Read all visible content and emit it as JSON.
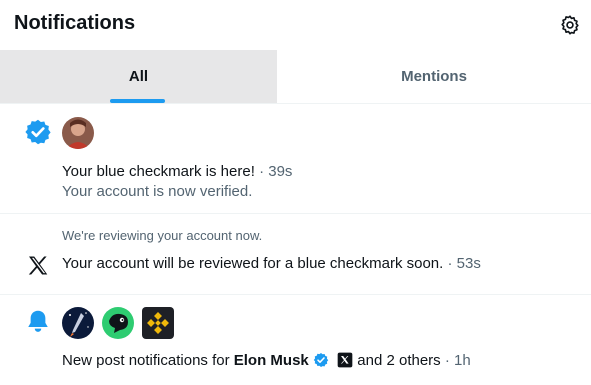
{
  "header": {
    "title": "Notifications",
    "settings_icon": "gear-icon"
  },
  "tabs": [
    {
      "label": "All",
      "active": true
    },
    {
      "label": "Mentions",
      "active": false
    }
  ],
  "notifications": [
    {
      "icon": "verified-badge-icon",
      "title": "Your blue checkmark is here!",
      "time": "· 39s",
      "subtitle": "Your account is now verified."
    },
    {
      "icon": "x-logo-icon",
      "context": "We're reviewing your account now.",
      "title": "Your account will be reviewed for a blue checkmark soon.",
      "time": "· 53s"
    },
    {
      "icon": "bell-icon",
      "prefix": "New post notifications for",
      "name": "Elon Musk",
      "suffix": "and 2 others",
      "time": "· 1h"
    }
  ],
  "colors": {
    "accent": "#1d9bf0",
    "text": "#0f1419",
    "muted": "#536471",
    "tab_active_bg": "#e7e7e8",
    "divider": "#eff3f4"
  }
}
